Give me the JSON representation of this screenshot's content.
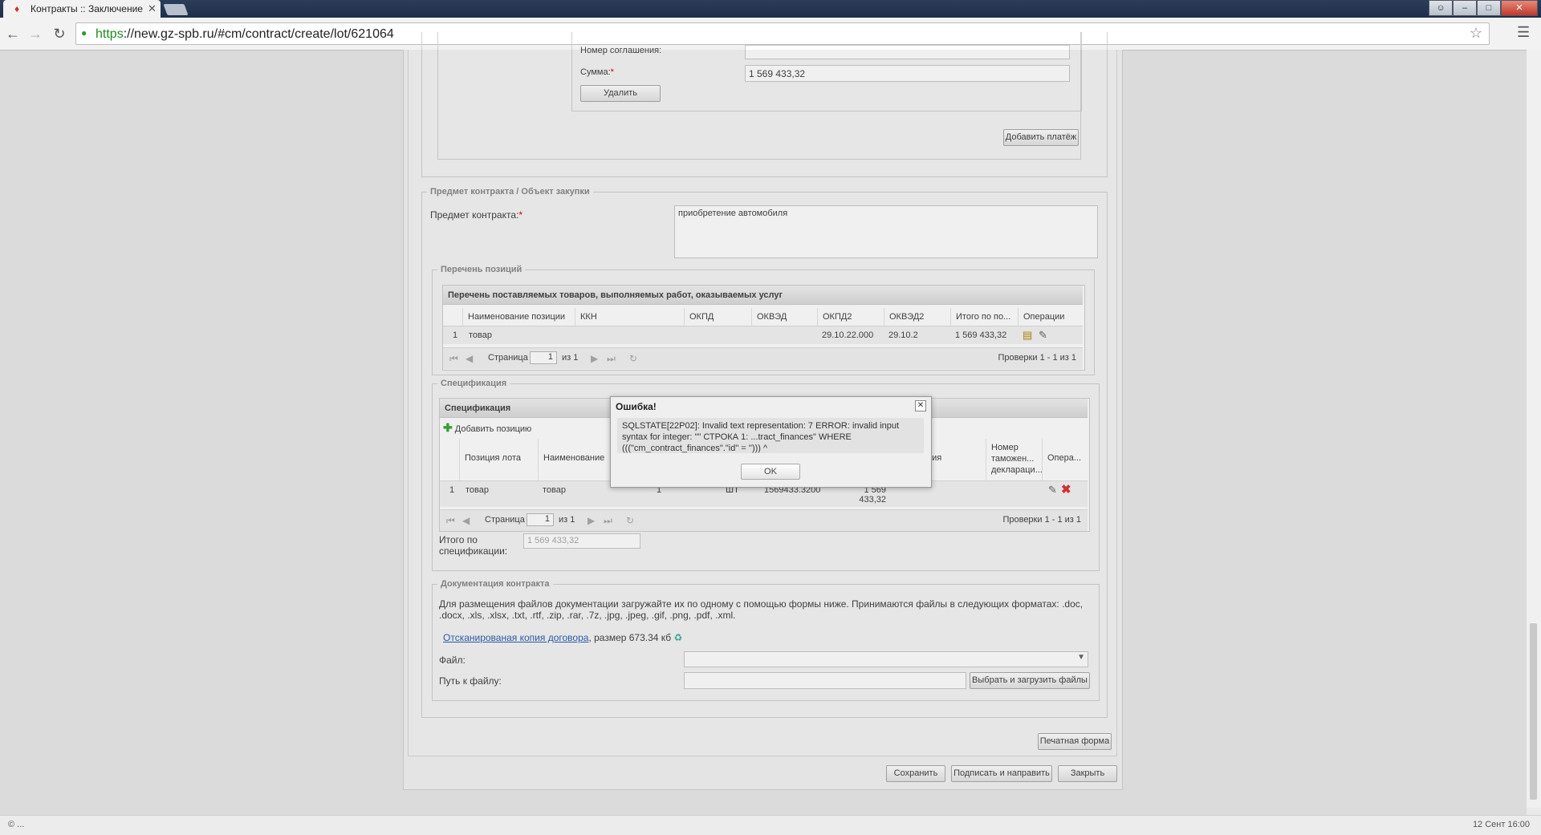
{
  "browser": {
    "tab_title": "Контракты :: Заключение",
    "url_scheme": "https",
    "url_rest": "://new.gz-spb.ru/#cm/contract/create/lot/621064"
  },
  "payment": {
    "agreement_label": "Номер соглашения:",
    "sum_label": "Сумма:",
    "sum_value": "1 569 433,32",
    "delete_button": "Удалить",
    "add_payment_button": "Добавить платёж"
  },
  "subject": {
    "legend": "Предмет контракта / Объект закупки",
    "label": "Предмет контракта:",
    "value": "приобретение автомобиля"
  },
  "positions": {
    "legend": "Перечень позиций",
    "grid_title": "Перечень поставляемых товаров, выполняемых работ, оказываемых услуг",
    "columns": [
      "Наименование позиции",
      "ККН",
      "ОКПД",
      "ОКВЭД",
      "ОКПД2",
      "ОКВЭД2",
      "Итого по по...",
      "Операции"
    ],
    "row": {
      "num": "1",
      "name": "товар",
      "okpd2": "29.10.22.000",
      "okved2": "29.10.2",
      "total": "1 569 433,32"
    },
    "pager": {
      "page_label": "Страница",
      "page": "1",
      "of": "из 1",
      "info": "Проверки 1 - 1 из 1"
    }
  },
  "spec": {
    "legend": "Спецификация",
    "grid_title": "Спецификация",
    "add_position": "Добавить позицию",
    "columns": [
      "Позиция лота",
      "Наименование",
      "ния",
      "Номер таможен... деклараци...",
      "Опера..."
    ],
    "row": {
      "num": "1",
      "lot_pos": "товар",
      "name": "товар",
      "qty": "1",
      "unit": "ШТ",
      "price": "1569433.3200",
      "sum": "1 569 433,32"
    },
    "pager": {
      "page_label": "Страница",
      "page": "1",
      "of": "из 1",
      "info": "Проверки 1 - 1 из 1"
    },
    "total_label": "Итого по спецификации:",
    "total_value": "1 569 433,32"
  },
  "docs": {
    "legend": "Документация контракта",
    "info": "Для размещения файлов документации загружайте их по одному с помощью формы ниже. Принимаются файлы в следующих форматах: .doc, .docx, .xls, .xlsx, .txt, .rtf, .zip, .rar, .7z, .jpg, .jpeg, .gif, .png, .pdf, .xml.",
    "file_link": "Отсканированая копия договора",
    "file_size": ", размер 673.34 кб",
    "file_label": "Файл:",
    "path_label": "Путь к файлу:",
    "upload_button": "Выбрать и загрузить файлы"
  },
  "actions": {
    "print_button": "Печатная форма",
    "save_button": "Сохранить",
    "sign_button": "Подписать и направить",
    "close_button": "Закрыть"
  },
  "dialog": {
    "title": "Ошибка!",
    "message": "SQLSTATE[22P02]: Invalid text representation: 7 ERROR: invalid input syntax for integer: \"\" СТРОКА 1: ...tract_finances\" WHERE (((\"cm_contract_finances\".\"id\" = ''))) ^",
    "ok": "OK"
  },
  "status": {
    "left": "© ...",
    "right": "12 Сент 16:00"
  }
}
